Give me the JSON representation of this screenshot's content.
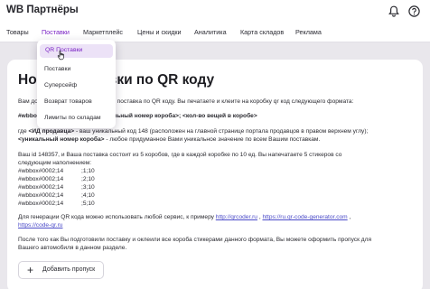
{
  "header": {
    "logo": "WB Партнёры",
    "icons": {
      "bell": "bell-icon",
      "help": "help-icon"
    }
  },
  "nav": {
    "items": [
      {
        "label": "Товары"
      },
      {
        "label": "Поставки"
      },
      {
        "label": "Маркетплейс"
      },
      {
        "label": "Цены и скидки"
      },
      {
        "label": "Аналитика"
      },
      {
        "label": "Карта складов"
      },
      {
        "label": "Реклама"
      }
    ]
  },
  "dropdown": {
    "items": [
      {
        "label": "QR Поставки"
      },
      {
        "label": "Поставки"
      },
      {
        "label": "Суперсейф"
      },
      {
        "label": "Возврат товаров"
      },
      {
        "label": "Лимиты по складам"
      }
    ]
  },
  "content": {
    "title": "Новые поставки по QR коду",
    "intro": "Вам доступна новая возможность - поставка по QR коду. Вы печатаете и клеите на коробку qr код следующего формата:",
    "format_line": "#wbbox#<ИД продавца>#<уникальный номер короба>; <кол-во вещей в коробе>",
    "where_prefix": "где ",
    "seller_id_bold": "<ИД продавца>",
    "where_text": " - ваш уникальный код 148          (расположен на главной странице портала продавцов в правом верхнем углу);",
    "box_bold": "<уникальный номер короба>",
    "box_text": " - любое придуманное Вами уникальное значение по всем Вашим поставкам.",
    "example_1": "Ваш id 148357, и Ваша поставка состоит из 5 коробов, где в каждой коробке по 10 ед. Вы напечатаете 5 стикеров со",
    "example_2": "следующим наполнением:",
    "codes": [
      {
        "code": "#wbbox#0002;14",
        "qty": ";1;10"
      },
      {
        "code": "#wbbox#0002;14",
        "qty": ";2;10"
      },
      {
        "code": "#wbbox#0002;14",
        "qty": ";3;10"
      },
      {
        "code": "#wbbox#0002;14",
        "qty": ";4;10"
      },
      {
        "code": "#wbbox#0002;14",
        "qty": ";5;10"
      }
    ],
    "qr_prefix": "Для генерации QR кода можно использовать любой сервис, к примеру ",
    "link_1": "http://qrcoder.ru",
    "sep_1": " , ",
    "link_2": "https://ru.qr-code-generator.com",
    "sep_2": " ,",
    "link_3": "https://code-qr.ru",
    "final_1": "После того как Вы подготовили поставку и оклеили все короба стикерами данного формата, Вы можете оформить пропуск для",
    "final_2": "Вашего автомобиля в данном разделе.",
    "add_button": "Добавить пропуск"
  }
}
